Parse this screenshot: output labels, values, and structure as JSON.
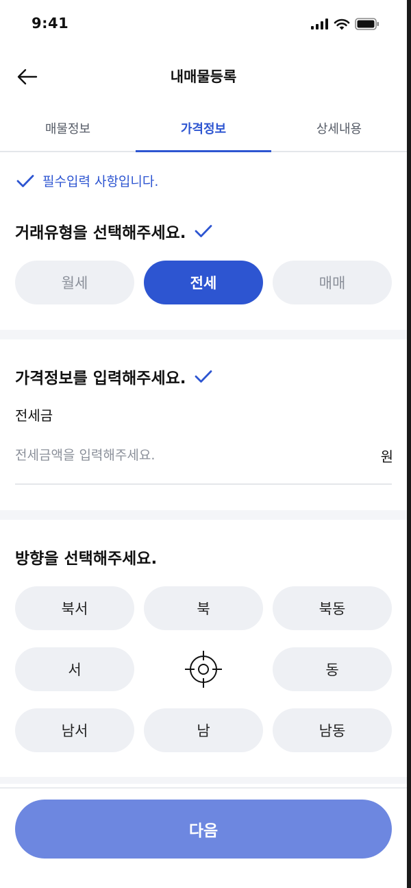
{
  "status_bar": {
    "time": "9:41"
  },
  "header": {
    "title": "내매물등록",
    "back_icon": "arrow-left-icon"
  },
  "tabs": [
    {
      "label": "매물정보",
      "active": false
    },
    {
      "label": "가격정보",
      "active": true
    },
    {
      "label": "상세내용",
      "active": false
    }
  ],
  "notice": {
    "text": "필수입력 사항입니다.",
    "icon": "check-icon"
  },
  "deal_type": {
    "title": "거래유형을 선택해주세요.",
    "options": [
      {
        "label": "월세",
        "selected": false
      },
      {
        "label": "전세",
        "selected": true
      },
      {
        "label": "매매",
        "selected": false
      }
    ]
  },
  "price": {
    "title": "가격정보를 입력해주세요.",
    "field_label": "전세금",
    "placeholder": "전세금액을 입력해주세요.",
    "value": "",
    "unit": "원"
  },
  "direction": {
    "title": "방향을 선택해주세요.",
    "rows": [
      [
        "북서",
        "북",
        "북동"
      ],
      [
        "서",
        "",
        "동"
      ],
      [
        "남서",
        "남",
        "남동"
      ]
    ],
    "center_icon": "crosshair-icon"
  },
  "footer": {
    "next_label": "다음"
  },
  "colors": {
    "primary": "#2d55d1",
    "primary_disabled": "#6d87e0",
    "pill_bg": "#eef0f4"
  }
}
